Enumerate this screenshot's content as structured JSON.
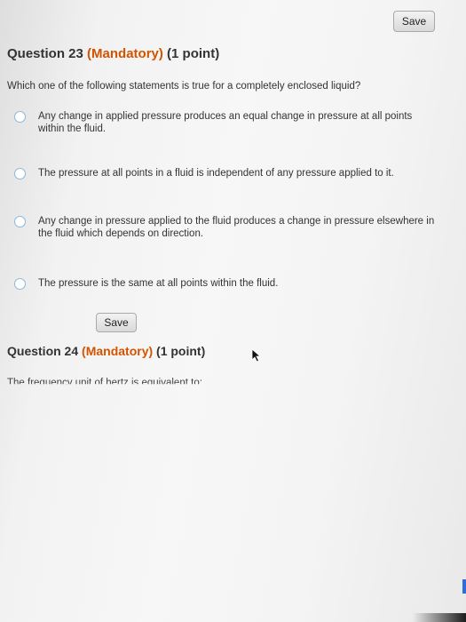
{
  "top_save": {
    "label": "Save"
  },
  "q23": {
    "number_label": "Question 23",
    "mandatory_label": "(Mandatory)",
    "points_label": "(1 point)",
    "prompt": "Which one of the following statements is true for a completely enclosed liquid?",
    "options": [
      {
        "text": "Any change in applied pressure produces an equal change in pressure at all points within the fluid."
      },
      {
        "text": "The pressure at all points in a fluid is independent of any pressure applied to it."
      },
      {
        "text": "Any change in pressure applied to the fluid produces a change in pressure elsewhere in the fluid which depends on direction."
      },
      {
        "text": "The pressure is the same at all points within the fluid."
      }
    ],
    "save_label": "Save"
  },
  "q24": {
    "number_label": "Question 24",
    "mandatory_label": "(Mandatory)",
    "points_label": "(1 point)",
    "prompt_partial": "The frequency unit of hertz is equivalent to:"
  },
  "colors": {
    "mandatory": "#d35400",
    "radio_border": "#8bb8d8"
  },
  "icons": {
    "cursor": "mouse-pointer-icon"
  }
}
